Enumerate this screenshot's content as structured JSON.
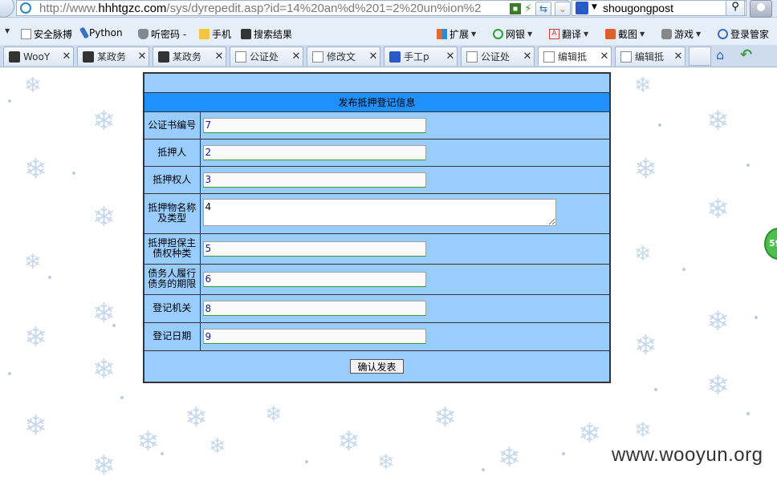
{
  "browser": {
    "url_prefix": "http://www.",
    "url_host": "hhhtgzc.com",
    "url_path": "/sys/dyrepedit.asp?id=14%20an%d%201=2%20un%ion%2",
    "search_text": "shougongpost"
  },
  "bookmarks": [
    {
      "label": "安全脉搏"
    },
    {
      "label": "Python"
    },
    {
      "label": "听密码 -"
    },
    {
      "label": "手机"
    },
    {
      "label": "搜索结果"
    }
  ],
  "toolbar_right": [
    {
      "label": "扩展"
    },
    {
      "label": "网银"
    },
    {
      "label": "翻译"
    },
    {
      "label": "截图"
    },
    {
      "label": "游戏"
    },
    {
      "label": "登录管家"
    }
  ],
  "tabs": [
    {
      "label": "WooY"
    },
    {
      "label": "某政务"
    },
    {
      "label": "某政务"
    },
    {
      "label": "公证处"
    },
    {
      "label": "修改文"
    },
    {
      "label": "手工p"
    },
    {
      "label": "公证处"
    },
    {
      "label": "编辑抵"
    },
    {
      "label": "编辑抵"
    }
  ],
  "form": {
    "title": "发布抵押登记信息",
    "fields": [
      {
        "label": "公证书编号",
        "value": "7"
      },
      {
        "label": "抵押人",
        "value": "2"
      },
      {
        "label": "抵押权人",
        "value": "3"
      },
      {
        "label": "抵押物名称及类型",
        "value": "4"
      },
      {
        "label": "抵押担保主债权种类",
        "value": "5"
      },
      {
        "label": "债务人履行债务的期限",
        "value": "6"
      },
      {
        "label": "登记机关",
        "value": "8"
      },
      {
        "label": "登记日期",
        "value": "9"
      }
    ],
    "submit_label": "确认发表"
  },
  "side_widget_text": "59",
  "watermark": "www.wooyun.org",
  "colors": {
    "form_bg": "#99ccff",
    "title_bg": "#1e90ff",
    "input_text": "#1a1aa8"
  }
}
